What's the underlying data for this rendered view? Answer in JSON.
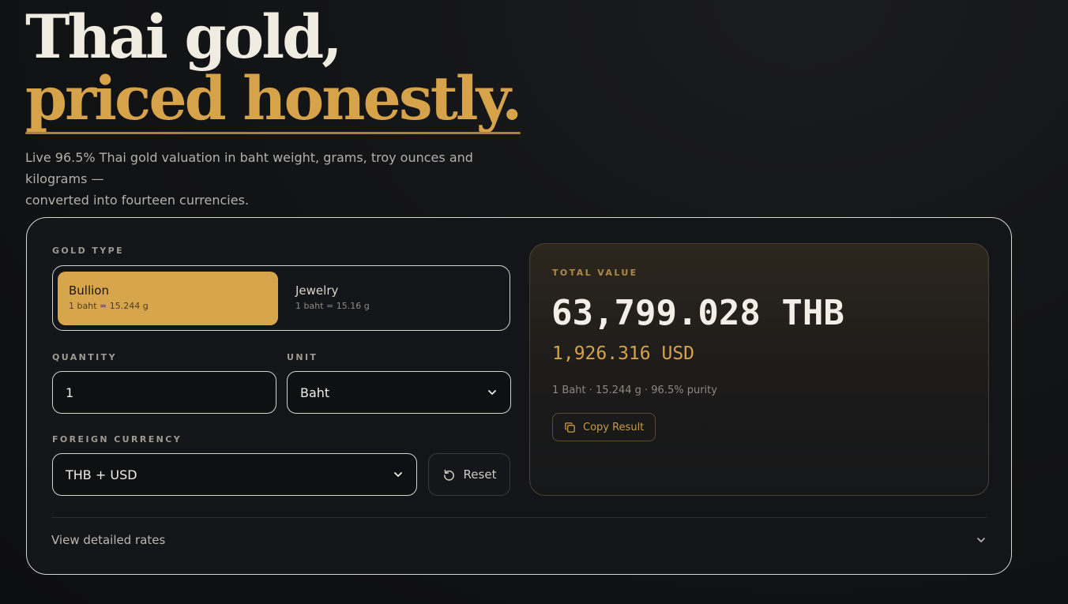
{
  "hero": {
    "title_line1": "Thai gold,",
    "title_line2": "priced honestly.",
    "subtitle_line1": "Live 96.5% Thai gold valuation in baht weight, grams, troy ounces and kilograms —",
    "subtitle_line2": "converted into fourteen currencies."
  },
  "calculator": {
    "gold_type_label": "GOLD TYPE",
    "gold_types": [
      {
        "title": "Bullion",
        "meta": "1 baht = 15.244 g",
        "selected": true
      },
      {
        "title": "Jewelry",
        "meta": "1 baht = 15.16 g",
        "selected": false
      }
    ],
    "quantity_label": "QUANTITY",
    "quantity_value": "1",
    "unit_label": "UNIT",
    "unit_value": "Baht",
    "currency_label": "FOREIGN CURRENCY",
    "currency_value": "THB + USD",
    "reset_label": "Reset",
    "details_label": "View detailed rates"
  },
  "result": {
    "label": "TOTAL VALUE",
    "primary": "63,799.028 THB",
    "secondary": "1,926.316 USD",
    "meta": "1 Baht · 15.244 g · 96.5% purity",
    "copy_label": "Copy Result"
  },
  "colors": {
    "accent": "#d7a64c",
    "background": "#131416",
    "border": "#d6d4cf"
  },
  "icons": {
    "reset": "rotate-ccw-icon",
    "copy": "copy-icon",
    "select": "chevron-down-icon"
  }
}
